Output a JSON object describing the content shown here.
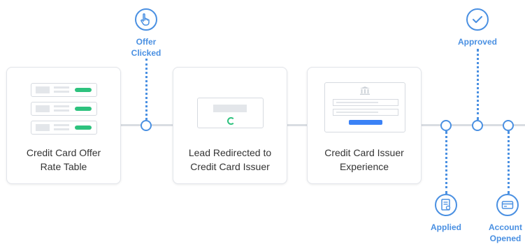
{
  "stages": [
    {
      "title": "Credit Card Offer\nRate Table"
    },
    {
      "title": "Lead Redirected to\nCredit Card Issuer"
    },
    {
      "title": "Credit Card Issuer\nExperience"
    }
  ],
  "events": {
    "offer_clicked": {
      "label": "Offer\nClicked",
      "icon": "hand-pointer-icon"
    },
    "approved": {
      "label": "Approved",
      "icon": "checkmark-icon"
    },
    "applied": {
      "label": "Applied",
      "icon": "application-form-icon"
    },
    "account_opened": {
      "label": "Account\nOpened",
      "icon": "credit-card-icon"
    }
  },
  "colors": {
    "accent": "#4a90e2",
    "green": "#2ec27e",
    "button_blue": "#3b82f6",
    "line": "#d9dde2"
  }
}
